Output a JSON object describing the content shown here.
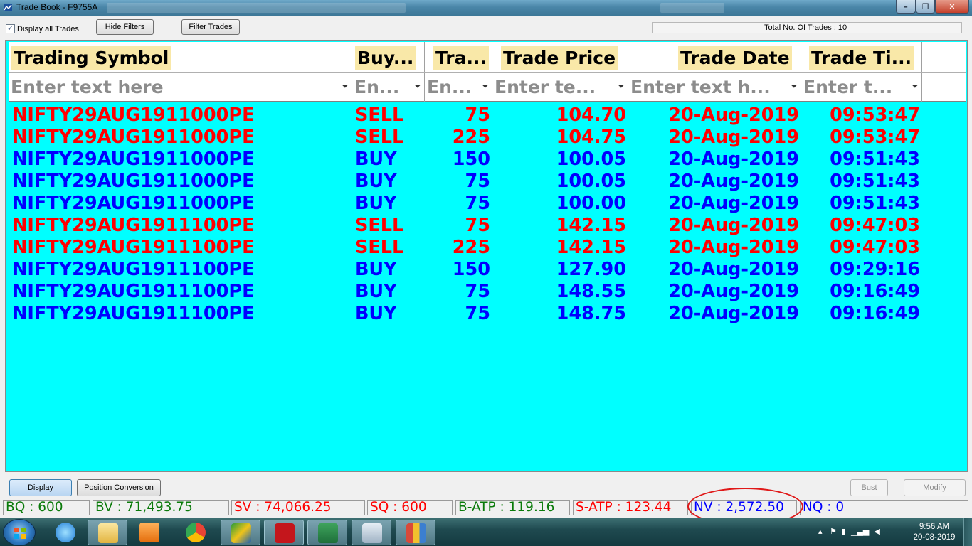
{
  "window": {
    "title": "Trade Book - F9755A",
    "minimize": "–",
    "maximize": "❐",
    "close": "✕"
  },
  "toolbar": {
    "display_all_label": "Display all Trades",
    "display_all_checked": true,
    "hide_filters": "Hide Filters",
    "filter_trades": "Filter Trades",
    "total_trades": "Total No. Of Trades : 10"
  },
  "columns": [
    "Trading Symbol",
    "Buy...",
    "Tra...",
    "Trade Price",
    "Trade Date",
    "Trade Ti..."
  ],
  "filter_placeholders": [
    "Enter text here",
    "En...",
    "En...",
    "Enter te...",
    "Enter text h...",
    "Enter t..."
  ],
  "rows": [
    {
      "symbol": "NIFTY29AUG1911000PE",
      "side": "SELL",
      "qty": "75",
      "price": "104.70",
      "date": "20-Aug-2019",
      "time": "09:53:47"
    },
    {
      "symbol": "NIFTY29AUG1911000PE",
      "side": "SELL",
      "qty": "225",
      "price": "104.75",
      "date": "20-Aug-2019",
      "time": "09:53:47"
    },
    {
      "symbol": "NIFTY29AUG1911000PE",
      "side": "BUY",
      "qty": "150",
      "price": "100.05",
      "date": "20-Aug-2019",
      "time": "09:51:43"
    },
    {
      "symbol": "NIFTY29AUG1911000PE",
      "side": "BUY",
      "qty": "75",
      "price": "100.05",
      "date": "20-Aug-2019",
      "time": "09:51:43"
    },
    {
      "symbol": "NIFTY29AUG1911000PE",
      "side": "BUY",
      "qty": "75",
      "price": "100.00",
      "date": "20-Aug-2019",
      "time": "09:51:43"
    },
    {
      "symbol": "NIFTY29AUG1911100PE",
      "side": "SELL",
      "qty": "75",
      "price": "142.15",
      "date": "20-Aug-2019",
      "time": "09:47:03"
    },
    {
      "symbol": "NIFTY29AUG1911100PE",
      "side": "SELL",
      "qty": "225",
      "price": "142.15",
      "date": "20-Aug-2019",
      "time": "09:47:03"
    },
    {
      "symbol": "NIFTY29AUG1911100PE",
      "side": "BUY",
      "qty": "150",
      "price": "127.90",
      "date": "20-Aug-2019",
      "time": "09:29:16"
    },
    {
      "symbol": "NIFTY29AUG1911100PE",
      "side": "BUY",
      "qty": "75",
      "price": "148.55",
      "date": "20-Aug-2019",
      "time": "09:16:49"
    },
    {
      "symbol": "NIFTY29AUG1911100PE",
      "side": "BUY",
      "qty": "75",
      "price": "148.75",
      "date": "20-Aug-2019",
      "time": "09:16:49"
    }
  ],
  "bottom": {
    "display": "Display",
    "position_conversion": "Position Conversion",
    "bust": "Bust",
    "modify": "Modify"
  },
  "status": {
    "bq": "BQ : 600",
    "bv": "BV : 71,493.75",
    "sv": "SV : 74,066.25",
    "sq": "SQ : 600",
    "batp": "B-ATP : 119.16",
    "satp": "S-ATP : 123.44",
    "nv": "NV : 2,572.50",
    "nq": "NQ : 0"
  },
  "colors": {
    "grid_bg": "#00ffff",
    "sell": "#ff0000",
    "buy": "#0000ff",
    "header_label_bg": "#f9e8a8",
    "annotation": "#e01818"
  },
  "taskbar": {
    "clock_time": "9:56 AM",
    "clock_date": "20-08-2019",
    "apps": [
      "start-orb-icon",
      "internet-explorer-icon",
      "file-explorer-icon",
      "media-player-icon",
      "chrome-icon",
      "trading-terminal-icon",
      "pdf-reader-icon",
      "excel-icon",
      "calculator-icon",
      "charting-icon"
    ]
  }
}
